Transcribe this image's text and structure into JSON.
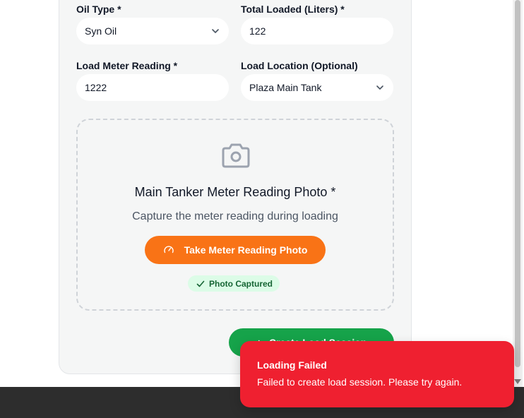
{
  "form": {
    "oil_type": {
      "label": "Oil Type *",
      "value": "Syn Oil"
    },
    "total_loaded": {
      "label": "Total Loaded (Liters) *",
      "value": "122"
    },
    "load_meter": {
      "label": "Load Meter Reading *",
      "value": "1222"
    },
    "load_location": {
      "label": "Load Location (Optional)",
      "value": "Plaza Main Tank"
    }
  },
  "photo": {
    "icon": "camera-icon",
    "title": "Main Tanker Meter Reading Photo *",
    "subtitle": "Capture the meter reading during loading",
    "button_label": "Take Meter Reading Photo",
    "button_icon": "gauge-icon",
    "badge": "Photo Captured",
    "badge_icon": "check-icon"
  },
  "actions": {
    "create_label": "Create Load Session"
  },
  "toast": {
    "title": "Loading Failed",
    "message": "Failed to create load session. Please try again."
  },
  "colors": {
    "accent_orange": "#f97316",
    "success_green": "#16a34a",
    "error_red": "#ef2030"
  }
}
